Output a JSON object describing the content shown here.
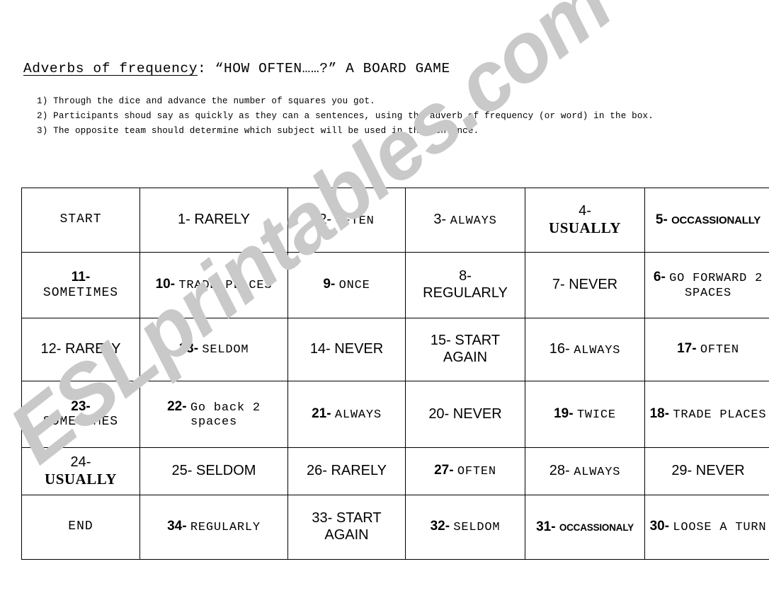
{
  "header": {
    "title_underlined": "Adverbs of frequency",
    "title_rest": ": “HOW OFTEN……?” A BOARD GAME",
    "instructions": [
      "1) Through the dice and advance the number of squares you got.",
      "2) Participants shoud say as quickly as they can a sentences, using the adverb of frequency (or word) in the box.",
      "3) The opposite team should determine which subject will be used in the sentence."
    ]
  },
  "watermark": {
    "text": "ESLprintables.com",
    "color": "#c9c9c9"
  },
  "board": {
    "rows": [
      [
        {
          "num": "",
          "label": "START",
          "style": "mono"
        },
        {
          "num": "1-",
          "label": "RARELY",
          "style": "sans-joined"
        },
        {
          "num": "2-",
          "label": "OFTEN",
          "style": "mono-joined"
        },
        {
          "num": "3-",
          "label": "ALWAYS",
          "style": "mono-joined"
        },
        {
          "num": "4-",
          "label": "USUALLY",
          "style": "serif-bold-stacked"
        },
        {
          "num": "5-",
          "label": "OCCASSIONALLY",
          "style": "cond-bold"
        }
      ],
      [
        {
          "num": "11-",
          "label": "SOMETIMES",
          "style": "mono-stacked"
        },
        {
          "num": "10-",
          "label": "TRADE PLACES",
          "style": "mono-wrap"
        },
        {
          "num": "9-",
          "label": "ONCE",
          "style": "mono-sm"
        },
        {
          "num": "8-",
          "label": "REGULARLY",
          "style": "sans-stacked"
        },
        {
          "num": "7-",
          "label": "NEVER",
          "style": "sans"
        },
        {
          "num": "6-",
          "label": "GO FORWARD 2 SPACES",
          "style": "mono-wrap"
        }
      ],
      [
        {
          "num": "12-",
          "label": "RARELY",
          "style": "sans"
        },
        {
          "num": "13-",
          "label": "SELDOM",
          "style": "mono-sm"
        },
        {
          "num": "14-",
          "label": "NEVER",
          "style": "sans"
        },
        {
          "num": "15-",
          "label": "START AGAIN",
          "style": "sans-wrap"
        },
        {
          "num": "16-",
          "label": "ALWAYS",
          "style": "mono-joined"
        },
        {
          "num": "17-",
          "label": "OFTEN",
          "style": "mono-sm"
        }
      ],
      [
        {
          "num": "23-",
          "label": "SOMETIMES",
          "style": "mono-stacked"
        },
        {
          "num": "22-",
          "label": "Go back 2 spaces",
          "style": "mono-wrap"
        },
        {
          "num": "21-",
          "label": "ALWAYS",
          "style": "mono-sm"
        },
        {
          "num": "20-",
          "label": "NEVER",
          "style": "sans"
        },
        {
          "num": "19-",
          "label": "TWICE",
          "style": "mono-sm"
        },
        {
          "num": "18-",
          "label": "TRADE PLACES",
          "style": "mono-wrap"
        }
      ],
      [
        {
          "num": "24-",
          "label": "USUALLY",
          "style": "serif-bold-stacked"
        },
        {
          "num": "25-",
          "label": "SELDOM",
          "style": "sans"
        },
        {
          "num": "26-",
          "label": "RARELY",
          "style": "sans"
        },
        {
          "num": "27-",
          "label": "OFTEN",
          "style": "mono-sm"
        },
        {
          "num": "28-",
          "label": "ALWAYS",
          "style": "mono-joined"
        },
        {
          "num": "29-",
          "label": "NEVER",
          "style": "sans"
        }
      ],
      [
        {
          "num": "",
          "label": "END",
          "style": "mono"
        },
        {
          "num": "34-",
          "label": "REGULARLY",
          "style": "mono-sm"
        },
        {
          "num": "33-",
          "label": "START AGAIN",
          "style": "sans-wrap"
        },
        {
          "num": "32-",
          "label": "SELDOM",
          "style": "mono-sm"
        },
        {
          "num": "31-",
          "label": "OCCASSIONALY",
          "style": "cond-bold-xs"
        },
        {
          "num": "30-",
          "label": "LOOSE A TURN",
          "style": "mono-wrap"
        }
      ]
    ]
  }
}
